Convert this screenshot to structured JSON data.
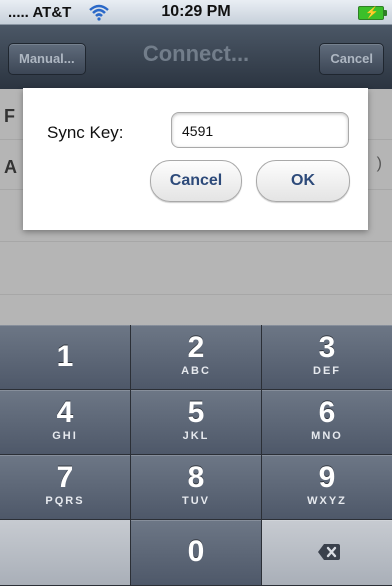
{
  "status_bar": {
    "carrier": "..... AT&T",
    "time": "10:29 PM",
    "wifi_icon": "wifi-icon",
    "battery_icon": "battery-charging-icon"
  },
  "nav_bar": {
    "left_button": "Manual...",
    "title": "Connect...",
    "right_button": "Cancel"
  },
  "background_rows": {
    "row1_partial": "F",
    "row2_partial": "A",
    "row2_trailing": ")"
  },
  "dialog": {
    "label": "Sync Key:",
    "field_value": "4591",
    "cancel_button": "Cancel",
    "ok_button": "OK"
  },
  "keypad": {
    "keys": [
      {
        "digit": "1",
        "letters": ""
      },
      {
        "digit": "2",
        "letters": "ABC"
      },
      {
        "digit": "3",
        "letters": "DEF"
      },
      {
        "digit": "4",
        "letters": "GHI"
      },
      {
        "digit": "5",
        "letters": "JKL"
      },
      {
        "digit": "6",
        "letters": "MNO"
      },
      {
        "digit": "7",
        "letters": "PQRS"
      },
      {
        "digit": "8",
        "letters": "TUV"
      },
      {
        "digit": "9",
        "letters": "WXYZ"
      },
      {
        "digit": "0",
        "letters": ""
      }
    ],
    "delete_icon": "backspace-icon"
  },
  "colors": {
    "nav_bar": "#2b3440",
    "dialog_button_text": "#2d4a7a",
    "key_face": "#5d6777",
    "battery": "#3bbf2a"
  }
}
